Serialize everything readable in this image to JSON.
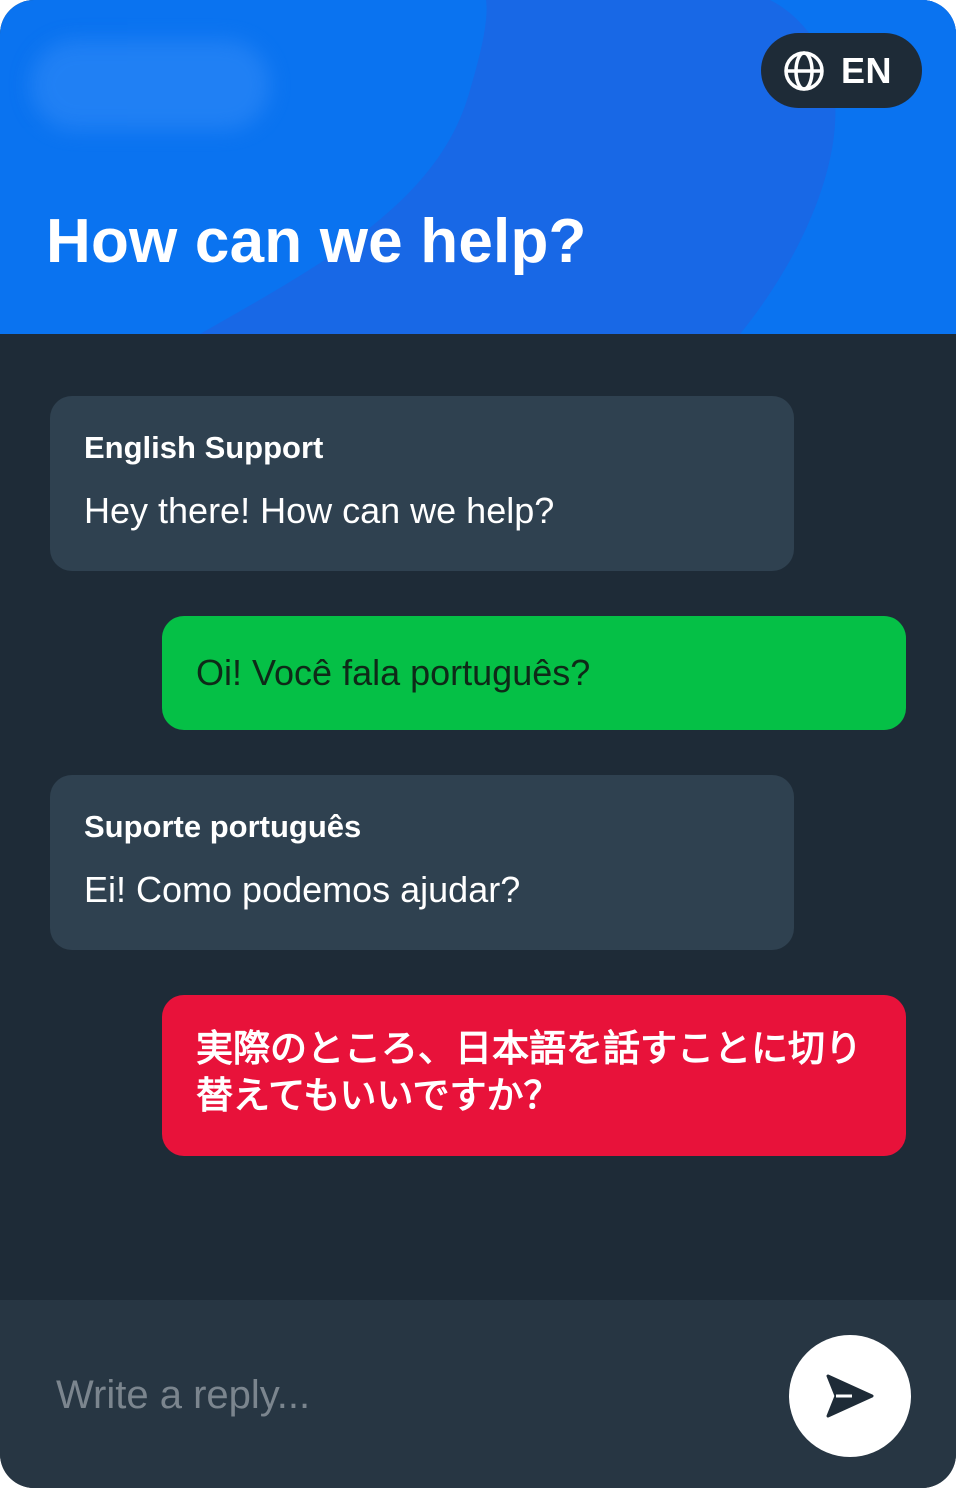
{
  "header": {
    "title": "How can we help?",
    "language": "EN",
    "language_icon": "globe-icon",
    "background_color": "#0a73f0"
  },
  "messages": [
    {
      "role": "agent",
      "sender": "English Support",
      "text": "Hey there! How can we help?",
      "color": "#2f4150"
    },
    {
      "role": "user",
      "text": "Oi! Você fala português?",
      "color": "#05c046"
    },
    {
      "role": "agent",
      "sender": "Suporte português",
      "text": "Ei! Como podemos ajudar?",
      "color": "#2f4150"
    },
    {
      "role": "user",
      "text": "実際のところ、日本語を話すことに切り替えてもいいですか？",
      "color": "#e8123a"
    }
  ],
  "composer": {
    "placeholder": "Write a reply...",
    "send_icon": "send-icon"
  }
}
